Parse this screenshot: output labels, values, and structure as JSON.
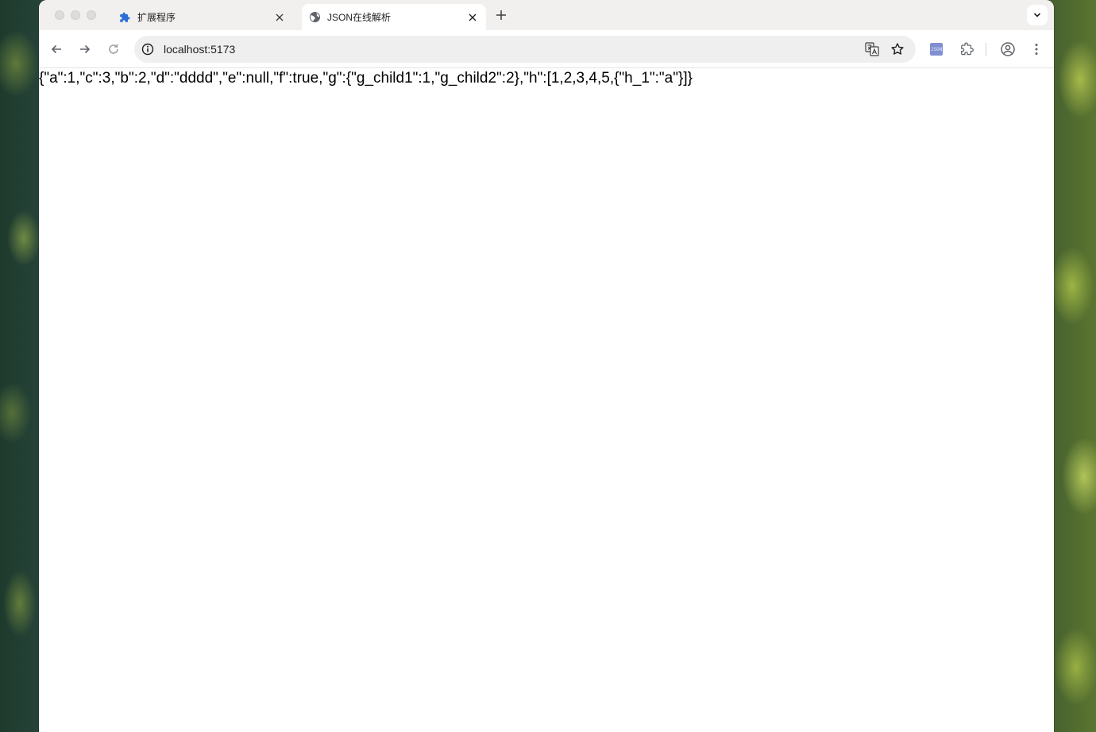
{
  "tabs": [
    {
      "title": "扩展程序",
      "icon": "puzzle-icon",
      "active": false
    },
    {
      "title": "JSON在线解析",
      "icon": "globe-icon",
      "active": true
    }
  ],
  "toolbar": {
    "url": "localhost:5173",
    "extension_badge": "JSON"
  },
  "page": {
    "raw_json": "{\"a\":1,\"c\":3,\"b\":2,\"d\":\"dddd\",\"e\":null,\"f\":true,\"g\":{\"g_child1\":1,\"g_child2\":2},\"h\":[1,2,3,4,5,{\"h_1\":\"a\"}]}"
  },
  "colors": {
    "tabstrip_bg": "#f1f0ee",
    "omnibox_bg": "#efefef",
    "puzzle_icon": "#2b6fd6",
    "text": "#1f1f1f"
  }
}
